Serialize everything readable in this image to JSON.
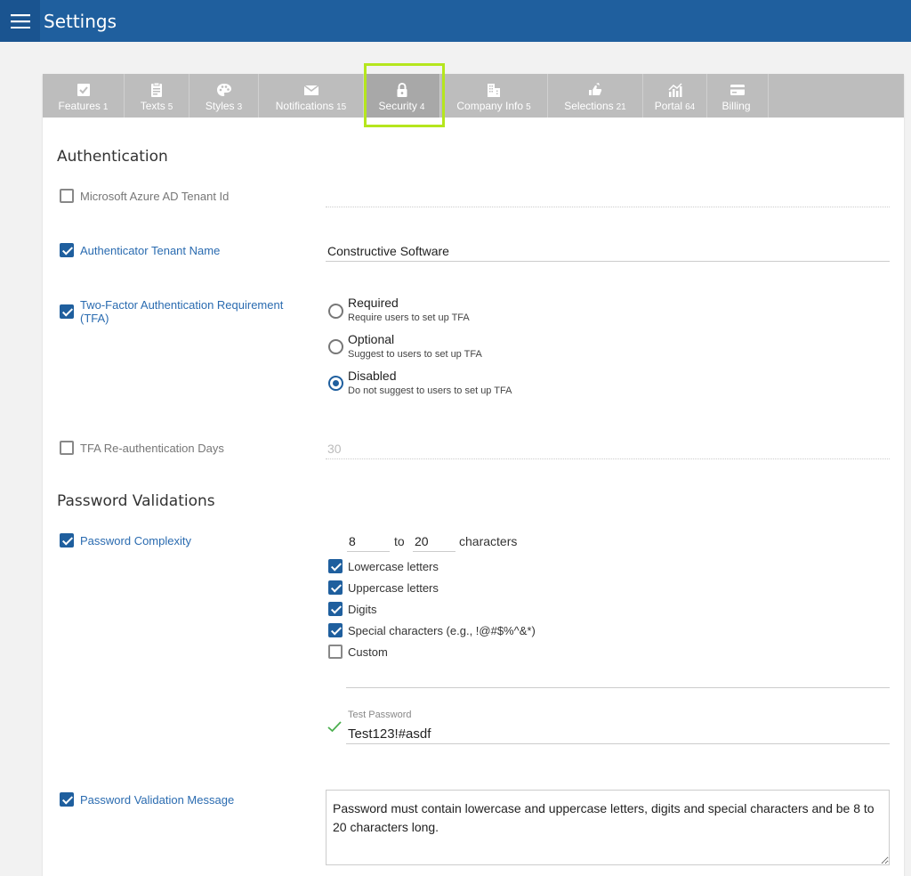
{
  "app": {
    "title": "Settings"
  },
  "tabs": [
    {
      "label": "Features",
      "count": "1",
      "icon": "checkbox-icon"
    },
    {
      "label": "Texts",
      "count": "5",
      "icon": "clipboard-icon"
    },
    {
      "label": "Styles",
      "count": "3",
      "icon": "palette-icon"
    },
    {
      "label": "Notifications",
      "count": "15",
      "icon": "envelope-icon"
    },
    {
      "label": "Security",
      "count": "4",
      "icon": "lock-icon",
      "active": true
    },
    {
      "label": "Company Info",
      "count": "5",
      "icon": "building-icon"
    },
    {
      "label": "Selections",
      "count": "21",
      "icon": "thumbs-icon"
    },
    {
      "label": "Portal",
      "count": "64",
      "icon": "chart-icon"
    },
    {
      "label": "Billing",
      "count": "",
      "icon": "credit-card-icon"
    }
  ],
  "authentication": {
    "title": "Authentication",
    "azure": {
      "label": "Microsoft Azure AD Tenant Id",
      "checked": false,
      "value": ""
    },
    "tenant_name": {
      "label": "Authenticator Tenant Name",
      "checked": true,
      "value": "Constructive Software"
    },
    "tfa": {
      "label": "Two-Factor Authentication Requirement (TFA)",
      "checked": true,
      "selected": "Disabled",
      "options": [
        {
          "title": "Required",
          "sub": "Require users to set up TFA"
        },
        {
          "title": "Optional",
          "sub": "Suggest to users to set up TFA"
        },
        {
          "title": "Disabled",
          "sub": "Do not suggest to users to set up TFA"
        }
      ]
    },
    "reauth": {
      "label": "TFA Re-authentication Days",
      "checked": false,
      "value": "30"
    }
  },
  "password": {
    "title": "Password Validations",
    "complexity": {
      "label": "Password Complexity",
      "checked": true,
      "min": "8",
      "to": "to",
      "max": "20",
      "unit": "characters",
      "rules": [
        {
          "label": "Lowercase letters",
          "checked": true
        },
        {
          "label": "Uppercase letters",
          "checked": true
        },
        {
          "label": "Digits",
          "checked": true
        },
        {
          "label": "Special characters (e.g., !@#$%^&*)",
          "checked": true
        },
        {
          "label": "Custom",
          "checked": false
        }
      ],
      "custom_value": ""
    },
    "test": {
      "label": "Test Password",
      "value": "Test123!#asdf"
    },
    "message": {
      "label": "Password Validation Message",
      "checked": true,
      "value": "Password must contain lowercase and uppercase letters, digits and special characters and be 8 to 20 characters long."
    }
  },
  "colors": {
    "brand": "#1f5f9e",
    "highlight": "#b5e61d",
    "tabbar": "#bdbdbd"
  }
}
